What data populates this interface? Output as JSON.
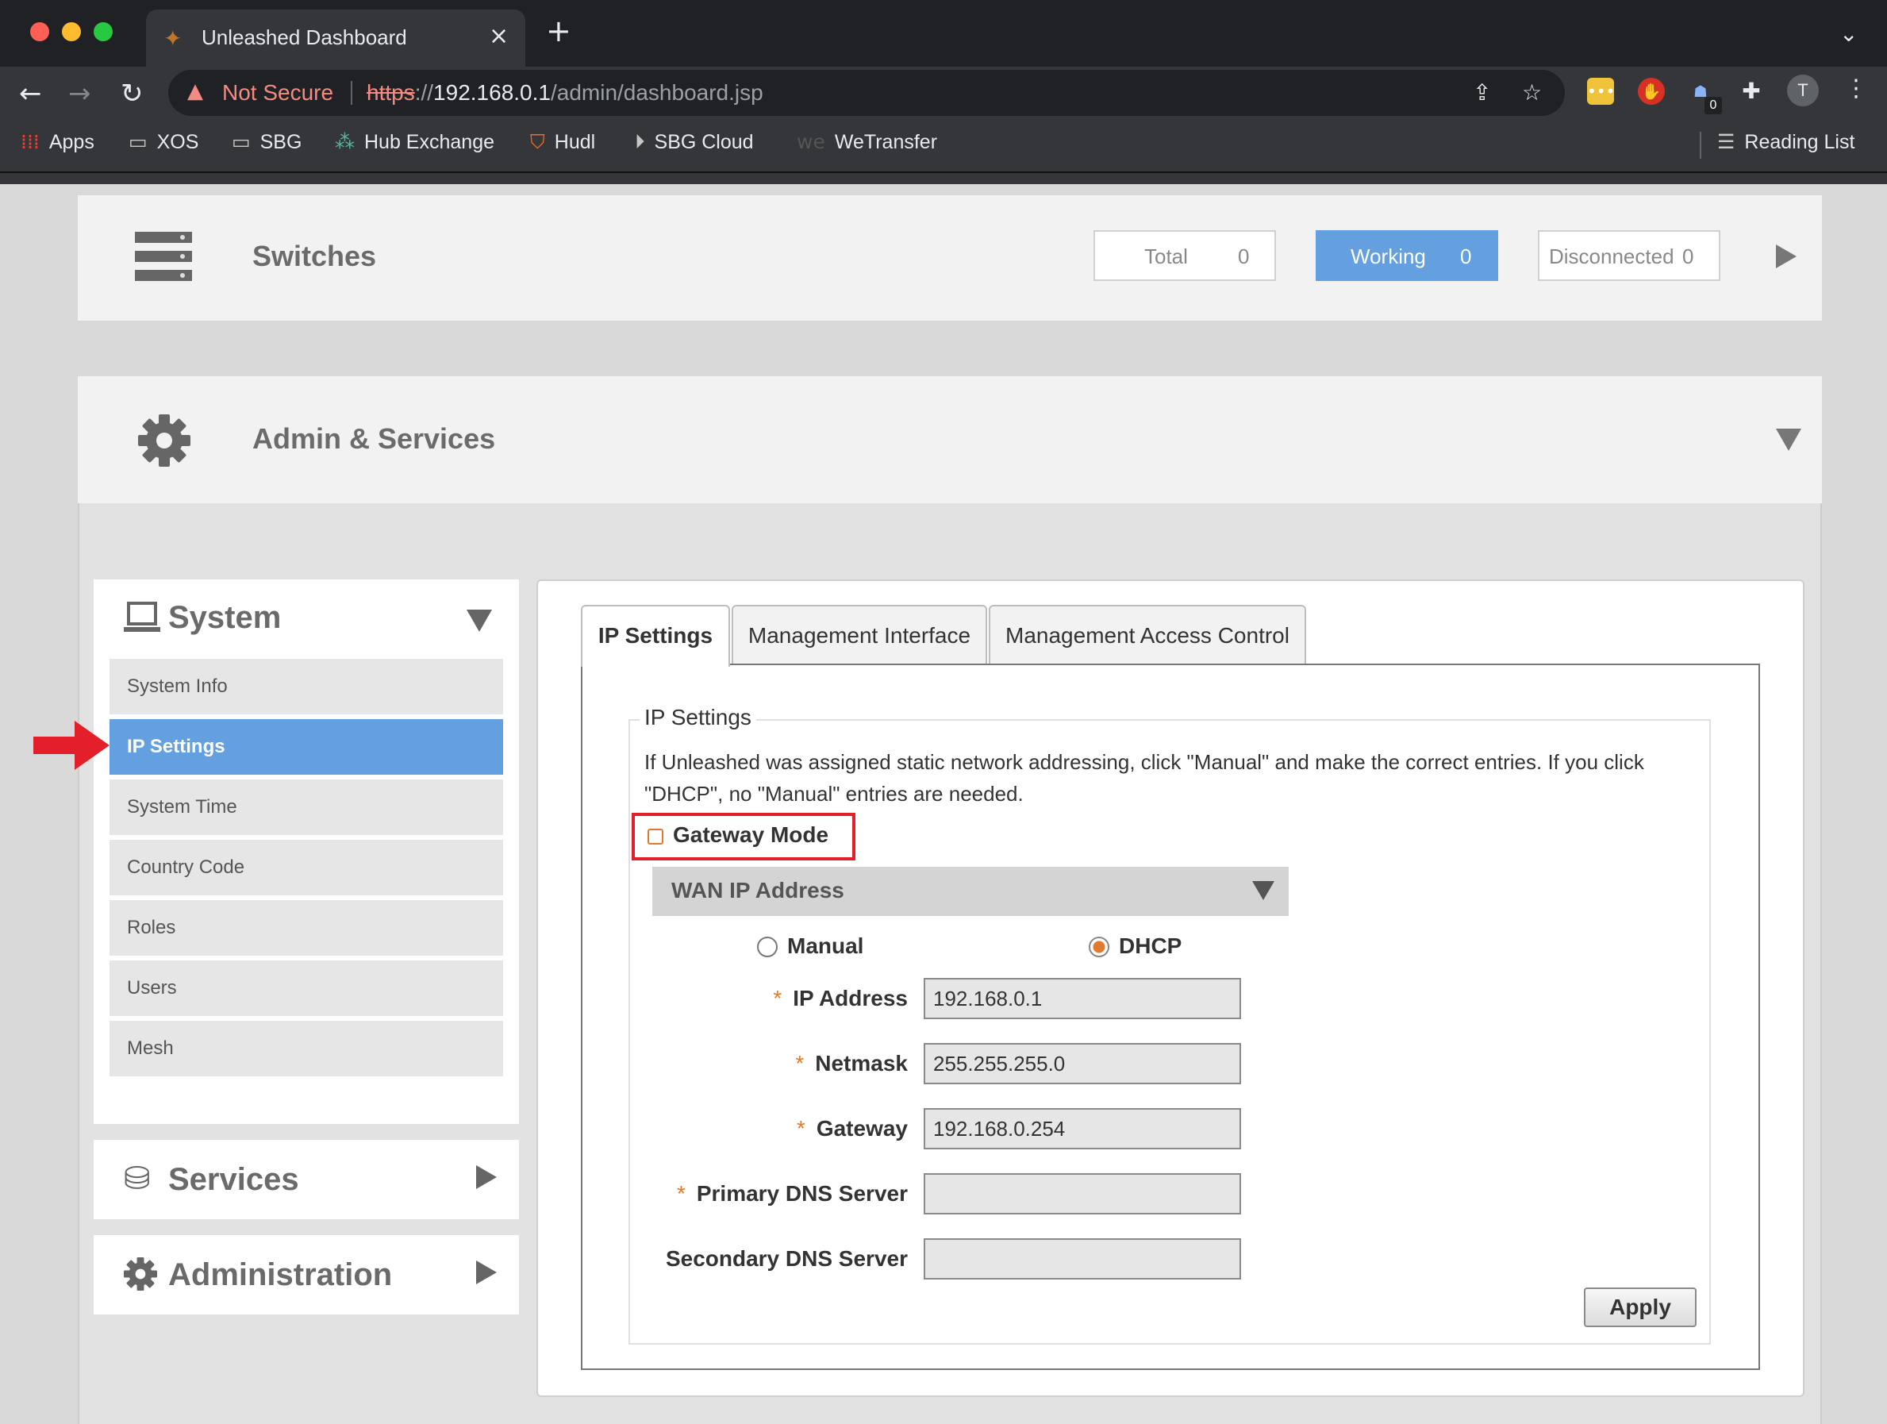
{
  "browser": {
    "tab_title": "Unleashed Dashboard",
    "not_secure": "Not Secure",
    "url_scheme": "https",
    "url_sep": "://",
    "url_host": "192.168.0.1",
    "url_path": "/admin/dashboard.jsp",
    "extension_badge": "0",
    "avatar_letter": "T",
    "bookmarks": [
      "Apps",
      "XOS",
      "SBG",
      "Hub Exchange",
      "Hudl",
      "SBG Cloud",
      "WeTransfer"
    ],
    "reading_list": "Reading List"
  },
  "switches": {
    "title": "Switches",
    "total_label": "Total",
    "total_value": "0",
    "working_label": "Working",
    "working_value": "0",
    "disconnected_label": "Disconnected",
    "disconnected_value": "0"
  },
  "admin_services": {
    "title": "Admin & Services"
  },
  "sidebar": {
    "system_title": "System",
    "items": [
      "System Info",
      "IP Settings",
      "System Time",
      "Country Code",
      "Roles",
      "Users",
      "Mesh"
    ],
    "active_item": "IP Settings",
    "services_title": "Services",
    "administration_title": "Administration"
  },
  "main": {
    "tabs": [
      "IP Settings",
      "Management Interface",
      "Management Access Control"
    ],
    "active_tab": "IP Settings",
    "legend": "IP Settings",
    "description": "If Unleashed was assigned static network addressing, click \"Manual\" and make the correct entries. If you click \"DHCP\", no \"Manual\" entries are needed.",
    "gateway_mode_label": "Gateway Mode",
    "gateway_mode_checked": false,
    "wan_section_title": "WAN IP Address",
    "mode_manual": "Manual",
    "mode_dhcp": "DHCP",
    "selected_mode": "DHCP",
    "fields": {
      "ip_address_label": "IP Address",
      "ip_address_value": "192.168.0.1",
      "netmask_label": "Netmask",
      "netmask_value": "255.255.255.0",
      "gateway_label": "Gateway",
      "gateway_value": "192.168.0.254",
      "primary_dns_label": "Primary DNS Server",
      "primary_dns_value": "",
      "secondary_dns_label": "Secondary DNS Server",
      "secondary_dns_value": ""
    },
    "required_mark": "*",
    "apply_label": "Apply"
  },
  "colors": {
    "accent_blue": "#64a0e0",
    "highlight_red": "#e3202a",
    "required_orange": "#e07a2e"
  }
}
